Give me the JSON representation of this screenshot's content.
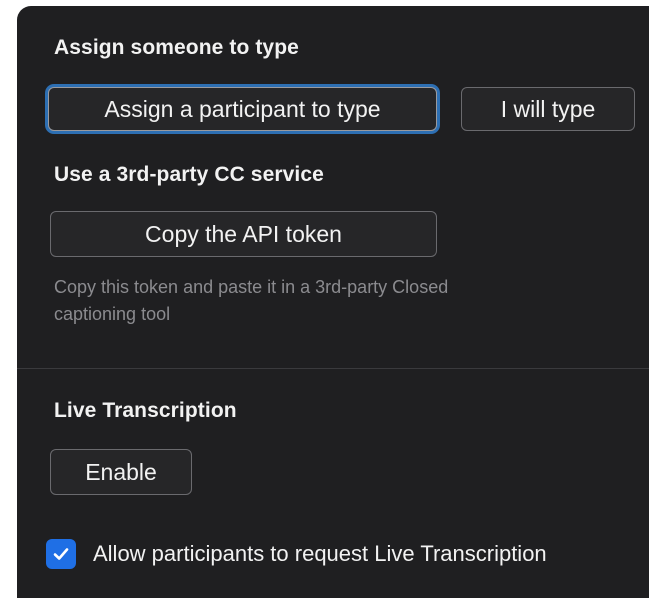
{
  "assign_section": {
    "title": "Assign someone to type",
    "assign_participant_label": "Assign a participant to type",
    "i_will_type_label": "I will type"
  },
  "cc_service_section": {
    "title": "Use a 3rd-party CC service",
    "copy_token_label": "Copy the API token",
    "hint_line1": "Copy this token and paste it in a 3rd-party Closed",
    "hint_line2": "captioning tool"
  },
  "live_transcription_section": {
    "title": "Live Transcription",
    "enable_label": "Enable",
    "allow_request_label": "Allow participants to request Live Transcription",
    "allow_request_checked": true
  },
  "colors": {
    "panel_bg": "#1f1f21",
    "focus_ring": "#2d6fb3",
    "checkbox_accent": "#1f6fe5"
  }
}
